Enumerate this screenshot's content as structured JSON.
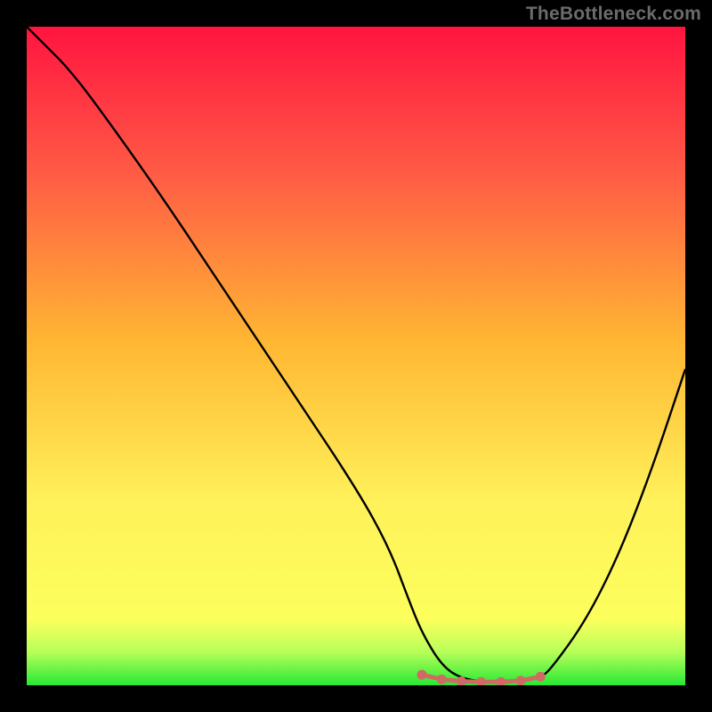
{
  "watermark": "TheBottleneck.com",
  "colors": {
    "black": "#000000",
    "curve": "#000000",
    "marker": "#cf6a65",
    "grad_top": "#ff1440",
    "grad_upper": "#ff5a45",
    "grad_mid": "#ffb733",
    "grad_lower": "#fff15a",
    "grad_yellow": "#fcff5c",
    "grad_lightg": "#b6ff59",
    "grad_green": "#27e833"
  },
  "chart_data": {
    "type": "line",
    "title": "",
    "xlabel": "",
    "ylabel": "",
    "xlim": [
      0,
      100
    ],
    "ylim": [
      0,
      100
    ],
    "grid": false,
    "legend": false,
    "series": [
      {
        "name": "bottleneck-curve",
        "x": [
          0,
          3,
          6,
          10,
          20,
          30,
          40,
          50,
          55,
          58,
          60,
          63,
          66,
          70,
          74,
          78,
          80,
          85,
          90,
          95,
          100
        ],
        "y": [
          100,
          97,
          94,
          89,
          75,
          60,
          45,
          30,
          21,
          13,
          8,
          3,
          1,
          0.5,
          0.5,
          1,
          3,
          10,
          20,
          33,
          48
        ]
      }
    ],
    "markers": {
      "name": "bottom-markers",
      "x": [
        60,
        63,
        66,
        69,
        72,
        75,
        78
      ],
      "y": [
        1.6,
        0.9,
        0.6,
        0.5,
        0.5,
        0.7,
        1.3
      ]
    }
  }
}
